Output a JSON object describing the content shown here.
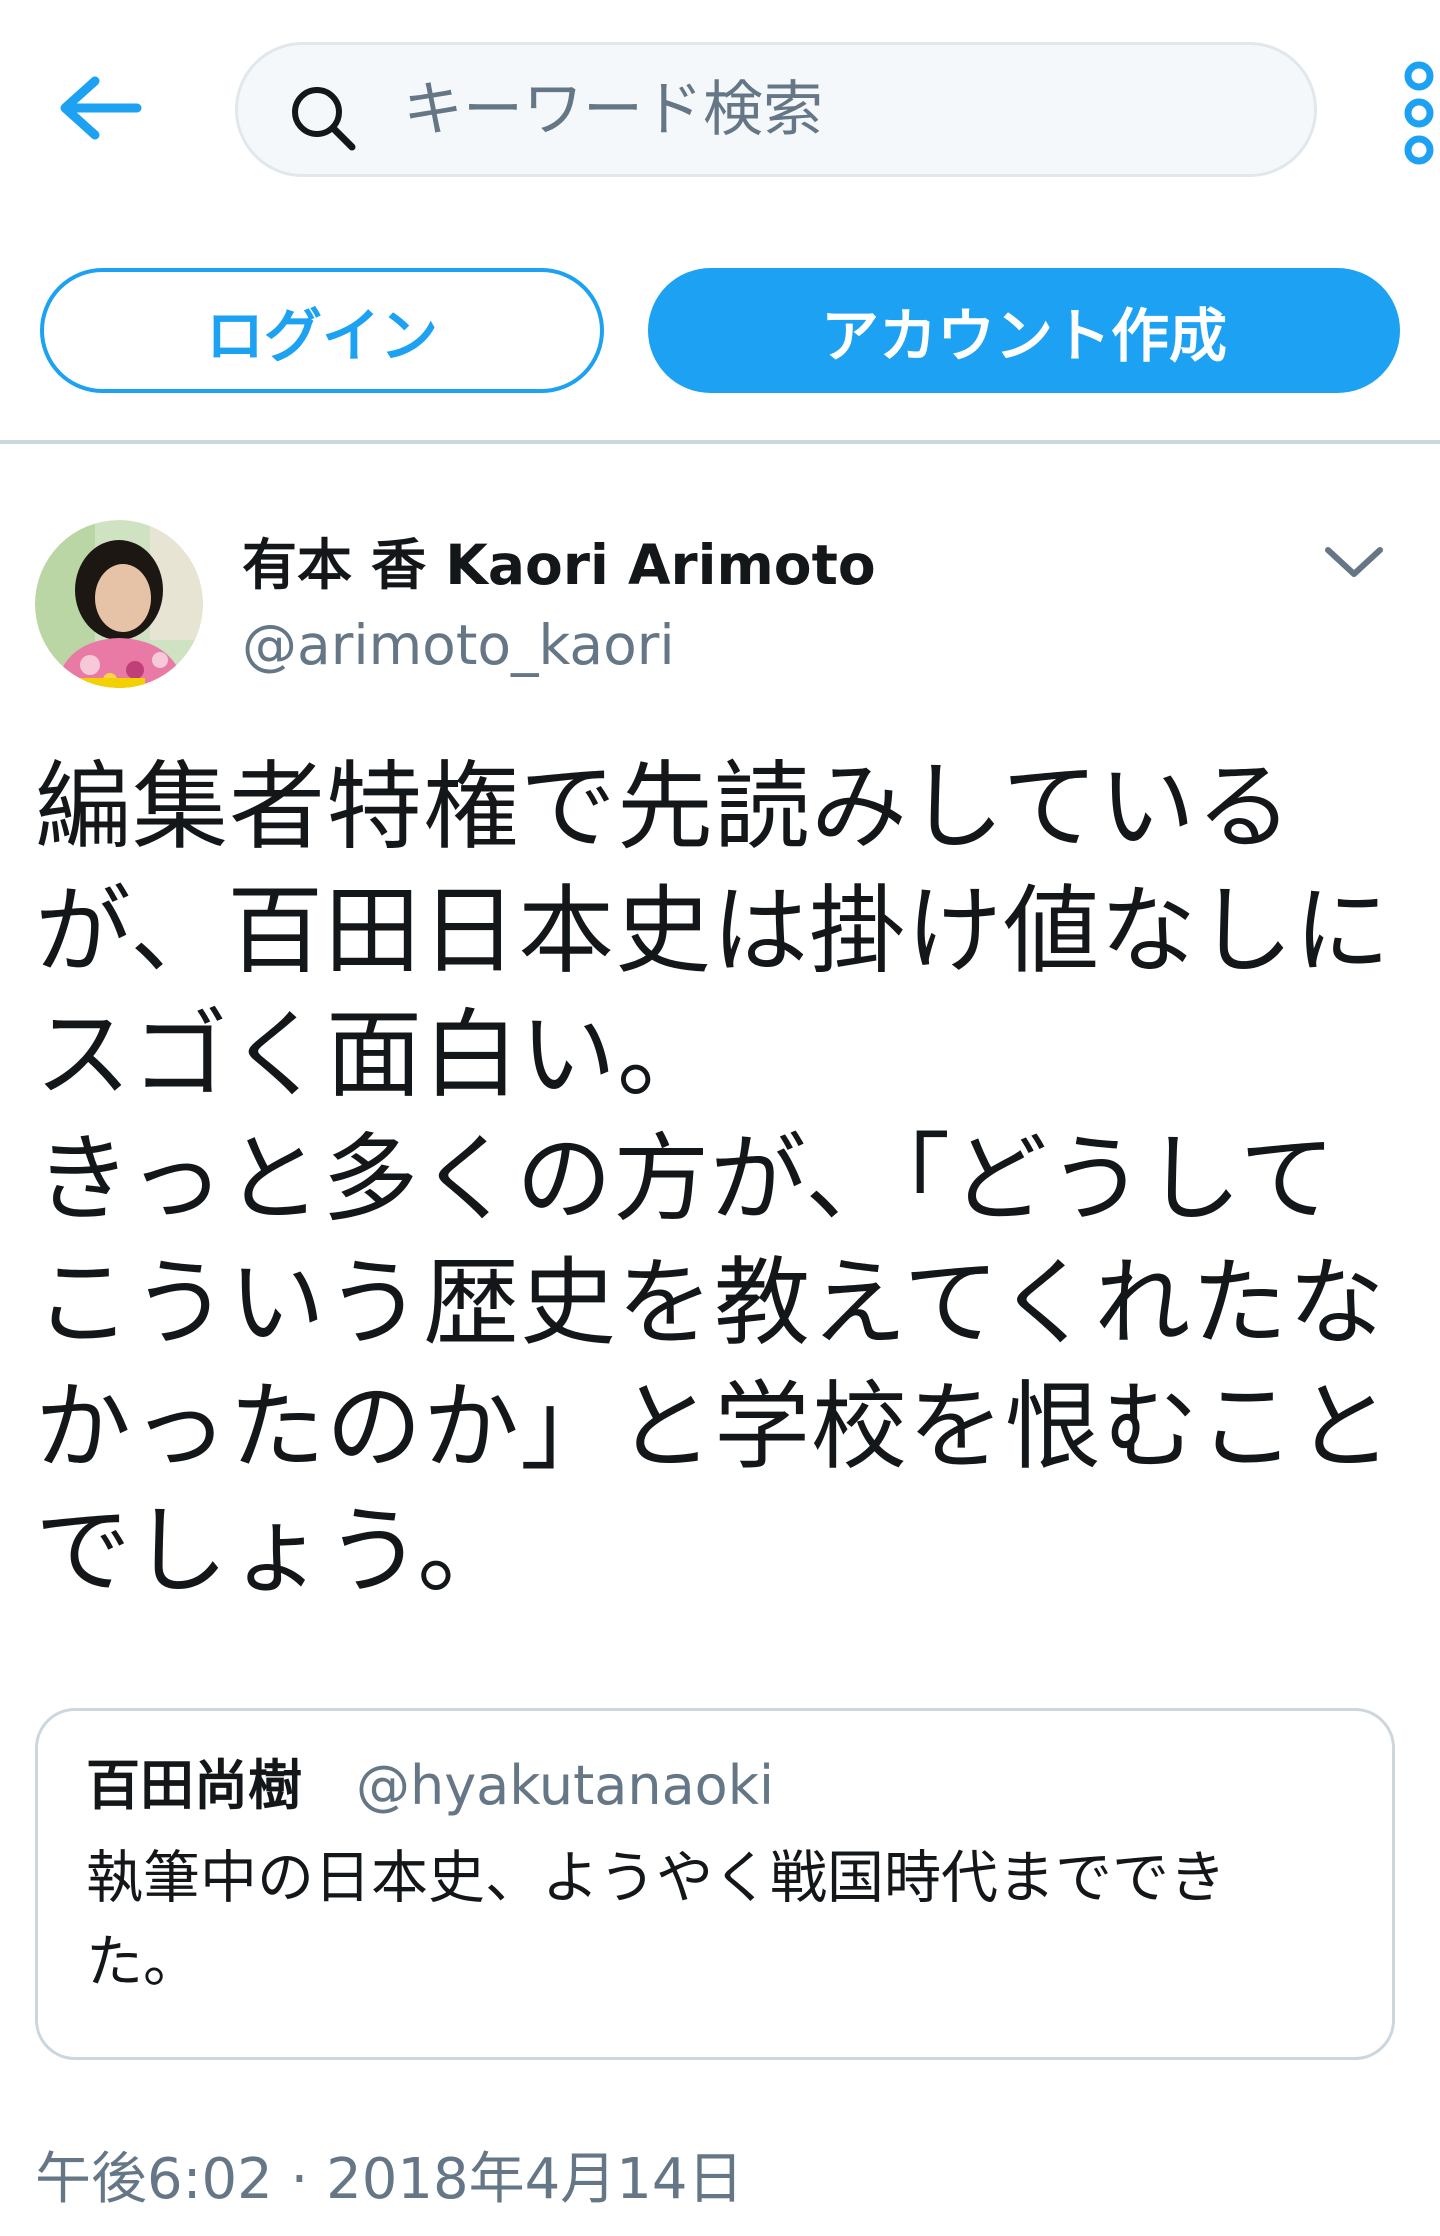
{
  "header": {
    "search": {
      "placeholder": "キーワード検索",
      "value": ""
    },
    "back_icon": "arrow-left-icon",
    "search_icon": "search-icon",
    "more_icon": "vertical-dots-icon"
  },
  "auth": {
    "login_label": "ログイン",
    "signup_label": "アカウント作成"
  },
  "tweet": {
    "display_name": "有本 香 Kaori Arimoto",
    "handle": "@arimoto_kaori",
    "text": "編集者特権で先読みしている\nが、百田日本史は掛け値なしに\nスゴく面白い。\nきっと多くの方が、「どうして\nこういう歴史を教えてくれたな\nかったのか」と学校を恨むこと\nでしょう。",
    "timestamp": "午後6:02 · 2018年4月14日",
    "quoted": {
      "display_name": "百田尚樹",
      "handle": "@hyakutanaoki",
      "text": "執筆中の日本史、ようやく戦国時代までできた。"
    }
  },
  "colors": {
    "accent": "#1da1f2",
    "text_primary": "#14171a",
    "text_secondary": "#657786",
    "border": "#ccd6dd",
    "search_bg": "#f5f8fa"
  }
}
